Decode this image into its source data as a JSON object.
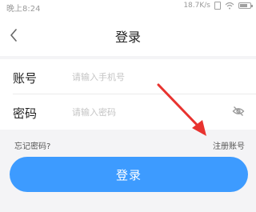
{
  "status_bar": {
    "time": "晚上8:24",
    "network_speed": "18.7K/s",
    "icons": [
      "sim-icon",
      "wifi-icon",
      "battery-icon"
    ]
  },
  "nav": {
    "back_icon": "chevron-left-icon",
    "title": "登录"
  },
  "form": {
    "account": {
      "label": "账号",
      "placeholder": "请输入手机号",
      "value": ""
    },
    "password": {
      "label": "密码",
      "placeholder": "请输入密码",
      "value": "",
      "toggle_icon": "eye-hidden-icon"
    }
  },
  "links": {
    "forgot_password": "忘记密码?",
    "register": "注册账号"
  },
  "login_button": {
    "label": "登录"
  },
  "colors": {
    "primary": "#3d9bff",
    "background": "#f4f4f6",
    "annotation_arrow": "#e8332f"
  }
}
